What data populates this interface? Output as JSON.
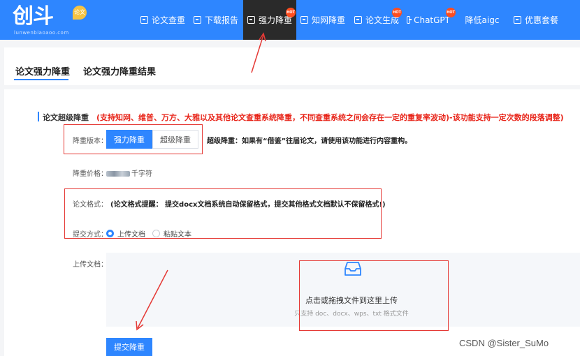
{
  "brand": {
    "logo_text": "创斗",
    "badge": "论文",
    "sub": "lunwenbiaoaoo.com"
  },
  "nav": {
    "items": [
      {
        "label": "论文查重",
        "icon": "document-check-icon"
      },
      {
        "label": "下载报告",
        "icon": "download-icon"
      },
      {
        "label": "强力降重",
        "icon": "rewrite-icon",
        "hot": "HOT",
        "active": true
      },
      {
        "label": "知网降重",
        "icon": "image-icon"
      },
      {
        "label": "论文生成",
        "icon": "document-generate-icon",
        "hot": "HOT"
      },
      {
        "label": "ChatGPT",
        "icon": "chat-icon",
        "hot": "HOT"
      },
      {
        "label": "降低aigc"
      },
      {
        "label": "优惠套餐",
        "icon": "gift-icon"
      }
    ]
  },
  "tabs": [
    "论文强力降重",
    "论文强力降重结果"
  ],
  "section": {
    "title": "论文超级降重",
    "note": "(支持知网、维普、万方、大雅以及其他论文查重系统降重，不同查重系统之间会存在一定的重复率波动)-该功能支持一定次数的段落调整)"
  },
  "form": {
    "version_label": "降重版本：",
    "version_options": [
      "强力降重",
      "超级降重"
    ],
    "version_selected": "强力降重",
    "version_desc": "超级降重：如果有“借鉴”往届论文，请使用该功能进行内容重构。",
    "price_label": "降重价格：",
    "price_suffix": "千字符",
    "format_label": "论文格式：",
    "format_note": "(论文格式提醒： 提交docx文档系统自动保留格式，提交其他格式文档默认不保留格式!)",
    "method_label": "提交方式：",
    "method_options": [
      "上传文档",
      "粘贴文本"
    ],
    "method_selected": "上传文档",
    "upload_label": "上传文档：",
    "upload_main": "点击或拖拽文件到这里上传",
    "upload_sub": "只支持 doc、docx、wps、txt 格式文件",
    "submit": "提交降重"
  },
  "watermark": "CSDN @Sister_SuMo",
  "colors": {
    "primary": "#2e86ff",
    "active_nav": "#2a2a2a",
    "warning": "#e8251a",
    "annotation": "#e53935"
  }
}
